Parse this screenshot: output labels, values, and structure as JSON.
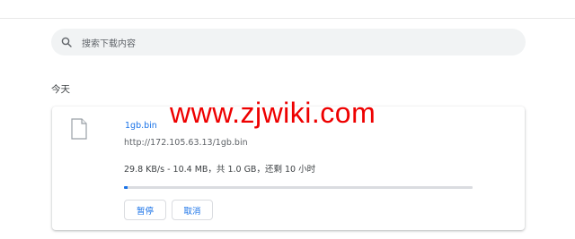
{
  "search": {
    "placeholder": "搜索下载内容",
    "icon": "search-icon"
  },
  "section": {
    "label": "今天"
  },
  "download": {
    "file_name": "1gb.bin",
    "url": "http://172.105.63.13/1gb.bin",
    "status": "29.8 KB/s - 10.4 MB，共 1.0 GB，还剩 10 小时",
    "progress": 0.0104,
    "icon": "file-icon",
    "pause_label": "暂停",
    "cancel_label": "取消"
  },
  "watermark": {
    "text": "www.zjwiki.com"
  },
  "colors": {
    "accent": "#1a73e8",
    "watermark": "#ee0000",
    "search_bg": "#f1f3f4"
  }
}
